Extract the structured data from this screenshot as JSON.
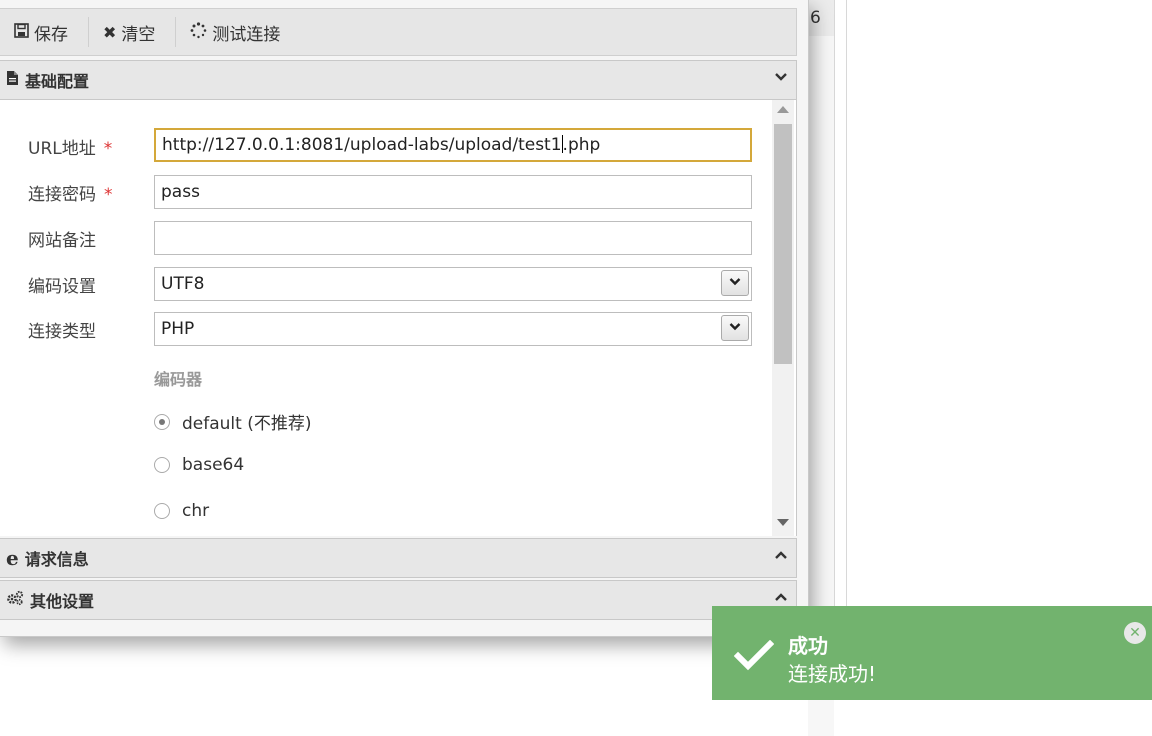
{
  "background": {
    "line_number": "6"
  },
  "toolbar": {
    "save_label": "保存",
    "clear_label": "清空",
    "test_label": "测试连接"
  },
  "sections": {
    "basic": "基础配置",
    "request": "请求信息",
    "other": "其他设置"
  },
  "form": {
    "url_label": "URL地址",
    "url_value_before_caret": "http://127.0.0.1:8081/upload-labs/upload/test1",
    "url_value_after_caret": ".php",
    "required_mark": "*",
    "password_label": "连接密码",
    "password_value": "pass",
    "note_label": "网站备注",
    "note_value": "",
    "encoding_label": "编码设置",
    "encoding_value": "UTF8",
    "type_label": "连接类型",
    "type_value": "PHP",
    "encoder_title": "编码器",
    "encoders": [
      {
        "label": "default (不推荐)",
        "selected": true
      },
      {
        "label": "base64",
        "selected": false
      },
      {
        "label": "chr",
        "selected": false
      }
    ]
  },
  "toast": {
    "title": "成功",
    "message": "连接成功!",
    "color": "#72b36e"
  }
}
